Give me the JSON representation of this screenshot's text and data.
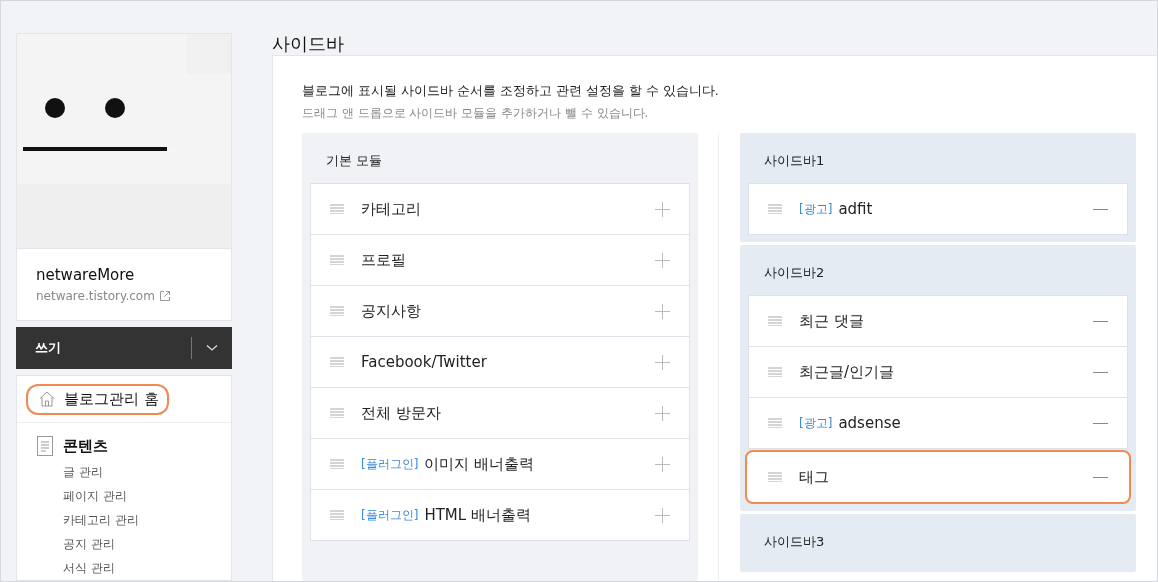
{
  "blog": {
    "name": "netwareMore",
    "url": "netware.tistory.com"
  },
  "write_button": {
    "label": "쓰기"
  },
  "menu": [
    {
      "kind": "home",
      "label": "블로그관리 홈",
      "highlighted": true
    },
    {
      "kind": "section",
      "label": "콘텐츠",
      "children": [
        {
          "label": "글 관리"
        },
        {
          "label": "페이지 관리"
        },
        {
          "label": "카테고리 관리"
        },
        {
          "label": "공지 관리"
        },
        {
          "label": "서식 관리"
        }
      ]
    }
  ],
  "page_title": "사이드바",
  "description": [
    "블로그에 표시될 사이드바 순서를 조정하고 관련 설정을 할 수 있습니다.",
    "드래그 앤 드롭으로 사이드바 모듈을 추가하거나 뺄 수 있습니다."
  ],
  "modules": {
    "title": "기본 모듈",
    "items": [
      {
        "name": "카테고리"
      },
      {
        "name": "프로필"
      },
      {
        "name": "공지사항"
      },
      {
        "name": "Facebook/Twitter"
      },
      {
        "name": "전체 방문자"
      },
      {
        "tag": "[플러그인]",
        "name": "이미지 배너출력"
      },
      {
        "tag": "[플러그인]",
        "name": "HTML 배너출력"
      }
    ]
  },
  "sidebars": [
    {
      "title": "사이드바1",
      "items": [
        {
          "tag": "[광고]",
          "name": "adfit",
          "highlighted": false
        }
      ]
    },
    {
      "title": "사이드바2",
      "items": [
        {
          "name": "최근 댓글",
          "highlighted": false
        },
        {
          "name": "최근글/인기글",
          "highlighted": false
        },
        {
          "tag": "[광고]",
          "name": "adsense",
          "highlighted": false
        },
        {
          "name": "태그",
          "highlighted": true
        }
      ]
    },
    {
      "title": "사이드바3"
    }
  ]
}
